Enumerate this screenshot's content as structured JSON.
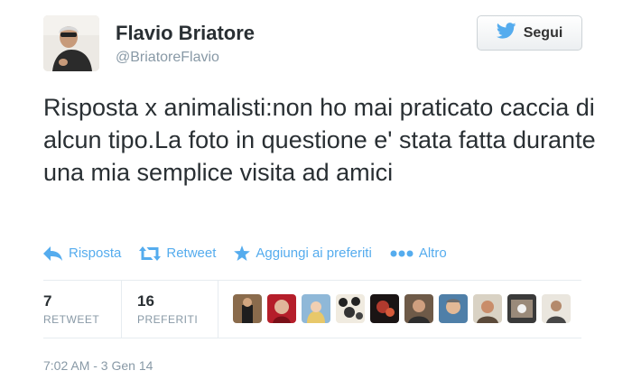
{
  "user": {
    "name": "Flavio Briatore",
    "handle": "@BriatoreFlavio",
    "avatar_icon": "profile-photo"
  },
  "follow_button": {
    "label": "Segui",
    "icon": "twitter-bird-icon"
  },
  "tweet": {
    "text": "Risposta x animalisti:non ho mai praticato caccia di alcun tipo.La foto in questione e' stata fatta durante una mia semplice visita ad amici"
  },
  "actions": {
    "reply": "Risposta",
    "retweet": "Retweet",
    "favorite": "Aggiungi ai preferiti",
    "more": "Altro"
  },
  "stats": {
    "retweets_count": "7",
    "retweets_label": "RETWEET",
    "favorites_count": "16",
    "favorites_label": "PREFERITI"
  },
  "timestamp": "7:02 AM - 3 Gen 14",
  "colors": {
    "accent": "#55acee",
    "text": "#292f33",
    "muted": "#8899a6",
    "divider": "#e6ecf0"
  }
}
